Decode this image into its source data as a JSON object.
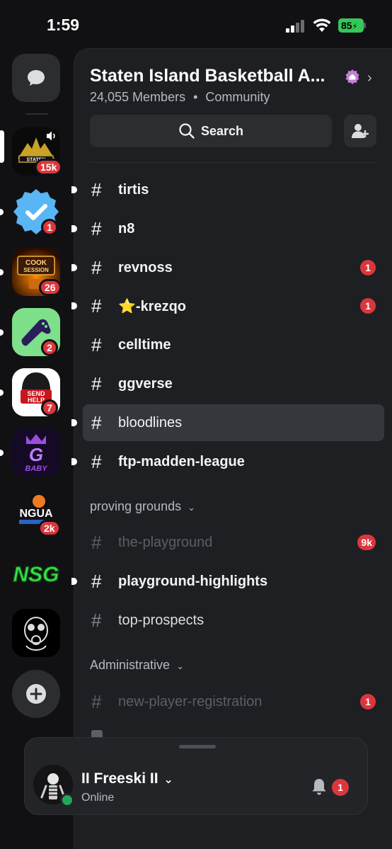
{
  "status_bar": {
    "time": "1:59",
    "battery": "85"
  },
  "rail": {
    "servers": [
      {
        "name": "STATEN",
        "badge": "15k"
      },
      {
        "name": "",
        "badge": "1"
      },
      {
        "name": "COOK SESSION",
        "badge": "26"
      },
      {
        "name": "",
        "badge": "2"
      },
      {
        "name": "SEND HELP",
        "badge": "7"
      },
      {
        "name": "G BABY",
        "badge": ""
      },
      {
        "name": "NGUA",
        "badge": "2k"
      },
      {
        "name": "NSG",
        "badge": ""
      },
      {
        "name": "",
        "badge": ""
      }
    ]
  },
  "header": {
    "server_name": "Staten Island Basketball A...",
    "members": "24,055 Members",
    "separator": "•",
    "type": "Community",
    "search_label": "Search"
  },
  "channels": [
    {
      "name": "tirtis",
      "badge": ""
    },
    {
      "name": "n8",
      "badge": ""
    },
    {
      "name": "revnoss",
      "badge": "1"
    },
    {
      "name": "⭐-krezqo",
      "badge": "1"
    },
    {
      "name": "celltime",
      "badge": ""
    },
    {
      "name": "ggverse",
      "badge": ""
    },
    {
      "name": "bloodlines",
      "badge": ""
    },
    {
      "name": "ftp-madden-league",
      "badge": ""
    }
  ],
  "categories": [
    {
      "name": "proving grounds",
      "channels": [
        {
          "name": "the-playground",
          "badge": "9k"
        },
        {
          "name": "playground-highlights",
          "badge": ""
        },
        {
          "name": "top-prospects",
          "badge": ""
        }
      ]
    },
    {
      "name": "Administrative",
      "channels": [
        {
          "name": "new-player-registration",
          "badge": "1"
        }
      ]
    }
  ],
  "user": {
    "name": "II Freeski II",
    "status": "Online",
    "notifications": "1"
  },
  "colors": {
    "background": "#111114",
    "panel": "#1e1f22",
    "badge": "#da373c",
    "online": "#23a55a",
    "battery": "#34c759"
  }
}
